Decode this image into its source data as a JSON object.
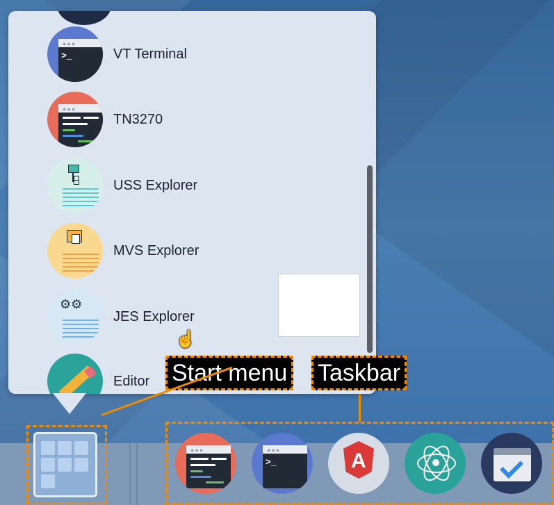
{
  "start_menu": {
    "items": [
      {
        "label": "VT Terminal",
        "icon": "vt-terminal-icon"
      },
      {
        "label": "TN3270",
        "icon": "tn3270-icon"
      },
      {
        "label": "USS Explorer",
        "icon": "uss-explorer-icon"
      },
      {
        "label": "MVS Explorer",
        "icon": "mvs-explorer-icon"
      },
      {
        "label": "JES Explorer",
        "icon": "jes-explorer-icon"
      },
      {
        "label": "Editor",
        "icon": "editor-icon"
      }
    ]
  },
  "annotations": {
    "start_menu_label": "Start menu",
    "taskbar_label": "Taskbar"
  },
  "taskbar": {
    "apps": [
      "tn3270-icon",
      "vt-terminal-icon",
      "angular-icon",
      "react-icon",
      "task-app-icon"
    ]
  },
  "colors": {
    "annotation": "#f08a00",
    "menu_bg": "#dde6f0",
    "desktop_bg": "#3a6fa7"
  }
}
